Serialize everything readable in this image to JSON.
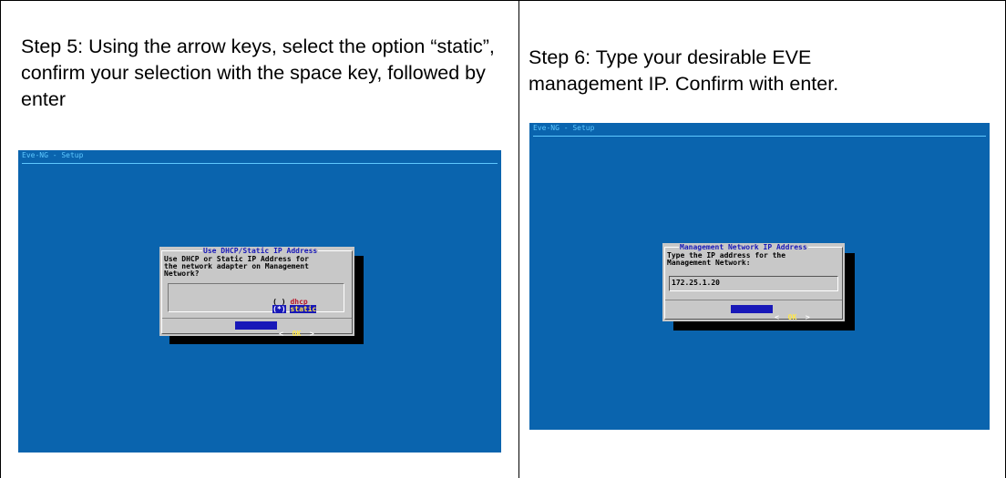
{
  "steps": [
    {
      "text": "Step 5: Using the arrow keys, select the option “static”, confirm your selection with the space key, followed by enter",
      "screen": {
        "title": "Eve-NG - Setup",
        "dialog": {
          "title": "Use DHCP/Static IP Address",
          "prompt_lines": [
            "Use DHCP or Static IP Address for",
            "the network adapter on Management",
            "Network?"
          ],
          "options": [
            {
              "marker": "( )",
              "label": "dhcp",
              "selected": false
            },
            {
              "marker": "(*)",
              "label": "static",
              "selected": true
            }
          ],
          "button": {
            "left": "<",
            "label": "OK",
            "right": ">"
          }
        }
      }
    },
    {
      "text": "Step 6: Type your desirable EVE management IP. Confirm with enter.",
      "screen": {
        "title": "Eve-NG - Setup",
        "dialog": {
          "title": "Management Network IP Address",
          "prompt_lines": [
            "Type the IP address for the",
            "Management Network:"
          ],
          "input_value": "172.25.1.20",
          "button": {
            "left": "<",
            "label": "OK",
            "right": ">"
          }
        }
      }
    }
  ],
  "colors": {
    "screen_bg": "#0a64ae",
    "dialog_bg": "#c8c8c8",
    "title_text": "#1818b8",
    "button_bg": "#1818b8",
    "button_text": "#ffe84a"
  }
}
